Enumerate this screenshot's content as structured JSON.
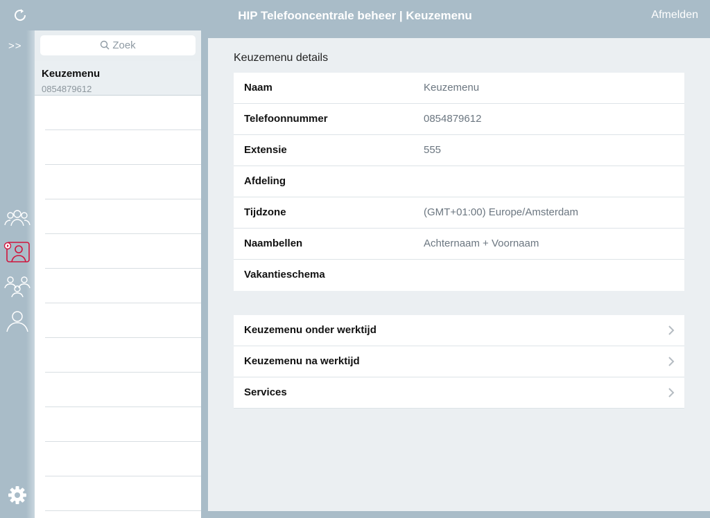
{
  "header": {
    "title": "HIP Telefooncentrale beheer | Keuzemenu",
    "logout_label": "Afmelden"
  },
  "rail": {
    "expand_label": ">>",
    "items": [
      {
        "name": "users-group-icon",
        "active": false
      },
      {
        "name": "ivr-menu-icon",
        "active": true
      },
      {
        "name": "hunt-group-icon",
        "active": false
      },
      {
        "name": "user-icon",
        "active": false
      }
    ],
    "accent_color": "#d0143c"
  },
  "search": {
    "placeholder": "Zoek"
  },
  "list": {
    "items": [
      {
        "name": "Keuzemenu",
        "number": "0854879612"
      }
    ]
  },
  "details": {
    "title": "Keuzemenu details",
    "rows": [
      {
        "label": "Naam",
        "value": "Keuzemenu"
      },
      {
        "label": "Telefoonnummer",
        "value": "0854879612"
      },
      {
        "label": "Extensie",
        "value": "555"
      },
      {
        "label": "Afdeling",
        "value": ""
      },
      {
        "label": "Tijdzone",
        "value": "(GMT+01:00) Europe/Amsterdam"
      },
      {
        "label": "Naambellen",
        "value": "Achternaam + Voornaam"
      },
      {
        "label": "Vakantieschema",
        "value": ""
      }
    ]
  },
  "links": [
    {
      "label": "Keuzemenu onder werktijd"
    },
    {
      "label": "Keuzemenu na werktijd"
    },
    {
      "label": "Services"
    }
  ]
}
